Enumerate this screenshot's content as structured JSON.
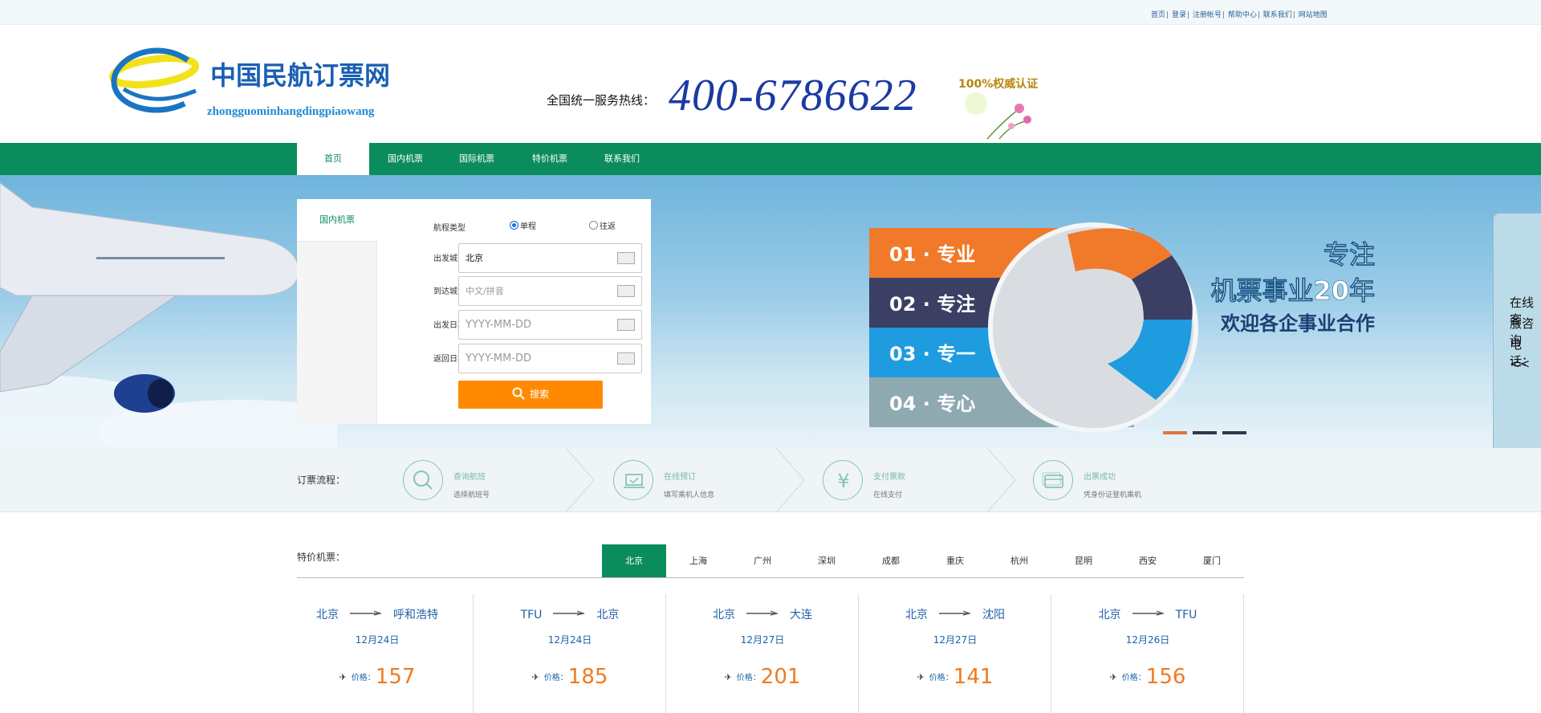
{
  "topbar": {
    "links": [
      "首页",
      "登录",
      "注册帐号",
      "帮助中心",
      "联系我们",
      "网站地图"
    ]
  },
  "header": {
    "logo_cn": "中国民航订票网",
    "logo_pinyin": "zhongguominhangdingpiaowang",
    "hotline_label": "全国统一服务热线：",
    "hotline_number": "400-6786622",
    "auth_text": "100%权威认证"
  },
  "nav": {
    "items": [
      "首页",
      "国内机票",
      "国际机票",
      "特价机票",
      "联系我们"
    ],
    "active": 0
  },
  "banner": {
    "slogan_1": "专注",
    "slogan_2": "机票事业20年",
    "slogan_3": "欢迎各企事业合作",
    "steps": [
      {
        "num": "01",
        "text": "专业"
      },
      {
        "num": "02",
        "text": "专注"
      },
      {
        "num": "03",
        "text": "专一"
      },
      {
        "num": "04",
        "text": "专心"
      }
    ],
    "active_dot": 0
  },
  "search": {
    "tab": "国内机票",
    "trip_label": "航程类型",
    "trip_oneway": "单程",
    "trip_round": "往返",
    "from_label": "出发城市",
    "from_value": "北京",
    "to_label": "到达城市",
    "to_placeholder": "中文/拼音",
    "depart_label": "出发日期",
    "depart_placeholder": "YYYY-MM-DD",
    "return_label": "返回日期",
    "return_placeholder": "YYYY-MM-DD",
    "button": "搜索"
  },
  "side_pull": {
    "lines": [
      "在线客",
      "服咨询",
      "电话：",
      "<<"
    ]
  },
  "features": {
    "title": "订票流程：",
    "items": [
      {
        "t1": "查询航班",
        "t2": "选择航班号"
      },
      {
        "t1": "在线预订",
        "t2": "填写乘机人信息"
      },
      {
        "t1": "支付票款",
        "t2": "在线支付"
      },
      {
        "t1": "出票成功",
        "t2": "凭身份证登机乘机"
      }
    ]
  },
  "flights": {
    "title": "特价机票：",
    "tabs": [
      "北京",
      "上海",
      "广州",
      "深圳",
      "成都",
      "重庆",
      "杭州",
      "昆明",
      "西安",
      "厦门"
    ],
    "active_tab": 0,
    "price_prefix": "价格：",
    "cards": [
      {
        "from": "北京",
        "to": "呼和浩特",
        "date": "12月24日",
        "price": "157"
      },
      {
        "from": "TFU",
        "to": "北京",
        "date": "12月24日",
        "price": "185"
      },
      {
        "from": "北京",
        "to": "大连",
        "date": "12月27日",
        "price": "201"
      },
      {
        "from": "北京",
        "to": "沈阳",
        "date": "12月27日",
        "price": "141"
      },
      {
        "from": "北京",
        "to": "TFU",
        "date": "12月26日",
        "price": "156"
      }
    ]
  },
  "colors": {
    "nav_green": "#0b8c5c",
    "orange": "#ff8a00",
    "price_orange": "#f07a1f",
    "link_blue": "#1f5fa6"
  }
}
